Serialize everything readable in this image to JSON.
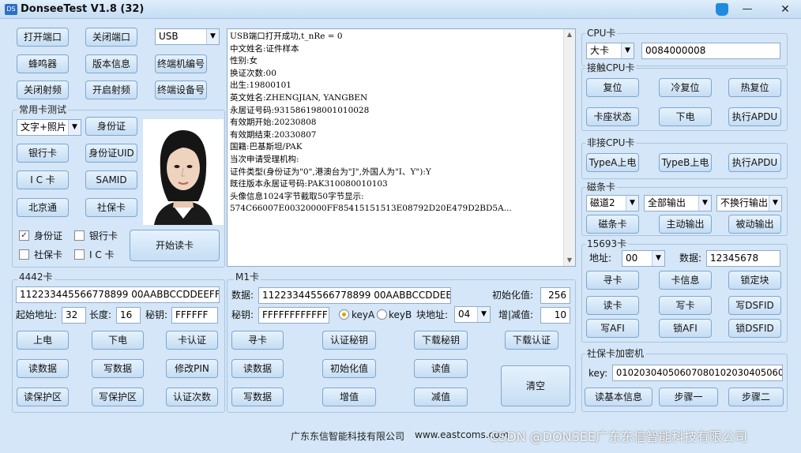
{
  "window": {
    "title": "DonseeTest V1.8  (32)",
    "icon_name": "app-icon",
    "skin_icon": "skin-icon",
    "minimize": "—",
    "close": "✕"
  },
  "top": {
    "open_port": "打开端口",
    "close_port": "关闭端口",
    "port_select": "USB",
    "buzzer": "蜂鸣器",
    "version": "版本信息",
    "terminal_no": "终端机编号",
    "rf_off": "关闭射频",
    "rf_on": "开启射频",
    "device_no": "终端设备号"
  },
  "common_card": {
    "label": "常用卡测试",
    "mode_select": "文字+照片",
    "id_card": "身份证",
    "bank_card": "银行卡",
    "id_uid": "身份证UID",
    "ic_card": "I C 卡",
    "samid": "SAMID",
    "beijing": "北京通",
    "social": "社保卡",
    "cb_id": "身份证",
    "cb_bank": "银行卡",
    "cb_social": "社保卡",
    "cb_ic": "I C 卡",
    "cb_id_checked": true,
    "start_read": "开始读卡"
  },
  "log": {
    "lines": [
      "USB端口打开成功,t_nRe = 0",
      "中文姓名:证件样本",
      "性别:女",
      "换证次数:00",
      "出生:19800101",
      "英文姓名:ZHENGJIAN, YANGBEN",
      "永居证号码:931586198001010028",
      "有效期开始:20230808",
      "有效期结束:20330807",
      "国籍:巴基斯坦/PAK",
      "当次申请受理机构:",
      "证件类型(身份证为\"0\",港澳台为\"J\",外国人为\"I、Y\"):Y",
      "既往版本永居证号码:PAK310080010103",
      "头像信息1024字节截取50字节显示:",
      "574C66007E00320000FF85415151513E08792D20E479D2BD5A..."
    ]
  },
  "card4442": {
    "label": "4442卡",
    "data": "112233445566778899 00AABBCCDDEEFF",
    "start_addr_label": "起始地址:",
    "start_addr": "32",
    "length_label": "长度:",
    "length": "16",
    "key_label": "秘钥:",
    "key": "FFFFFF",
    "power_on": "上电",
    "power_off": "下电",
    "card_auth": "卡认证",
    "read_data": "读数据",
    "write_data": "写数据",
    "change_pin": "修改PIN",
    "read_protect": "读保护区",
    "write_protect": "写保护区",
    "auth_count": "认证次数"
  },
  "m1": {
    "label": "M1卡",
    "data_label": "数据:",
    "data": "112233445566778899 00AABBCCDDEEFF",
    "init_label": "初始化值:",
    "init_value": "256",
    "key_label": "秘钥:",
    "key": "FFFFFFFFFFFF",
    "keyA": "keyA",
    "keyB": "keyB",
    "block_label": "块地址:",
    "block": "04",
    "incdec_label": "增|减值:",
    "incdec": "10",
    "find_card": "寻卡",
    "auth_key": "认证秘钥",
    "download_key": "下载秘钥",
    "download_auth": "下载认证",
    "read_data": "读数据",
    "init_val": "初始化值",
    "read_val": "读值",
    "write_data": "写数据",
    "inc_val": "增值",
    "dec_val": "减值",
    "clear": "清空"
  },
  "cpu": {
    "label": "CPU卡",
    "card_select": "大卡",
    "card_value": "0084000008",
    "contact_label": "接触CPU卡",
    "reset": "复位",
    "cold_reset": "冷复位",
    "hot_reset": "热复位",
    "slot_status": "卡座状态",
    "power_off": "下电",
    "exec_apdu": "执行APDU",
    "contactless_label": "非接CPU卡",
    "typeA": "TypeA上电",
    "typeB": "TypeB上电",
    "exec_apdu2": "执行APDU"
  },
  "mag": {
    "label": "磁条卡",
    "track": "磁道2",
    "output_all": "全部输出",
    "no_newline": "不换行输出",
    "mag_card": "磁条卡",
    "active_out": "主动输出",
    "passive_out": "被动输出"
  },
  "c15693": {
    "label": "15693卡",
    "addr_label": "地址:",
    "addr": "00",
    "data_label": "数据:",
    "data": "12345678",
    "find": "寻卡",
    "info": "卡信息",
    "lock_block": "锁定块",
    "read": "读卡",
    "write": "写卡",
    "write_dsfid": "写DSFID",
    "write_afi": "写AFI",
    "lock_afi": "锁AFI",
    "lock_dsfid": "锁DSFID"
  },
  "social_enc": {
    "label": "社保卡加密机",
    "key_label": "key:",
    "key": "0102030405060708010203040506070",
    "read_basic": "读基本信息",
    "step1": "步骤一",
    "step2": "步骤二"
  },
  "footer": {
    "company": "广东东信智能科技有限公司",
    "url": "www.eastcoms.com",
    "watermark": "CSDN @DONSEE广东东信智能科技有限公司"
  }
}
